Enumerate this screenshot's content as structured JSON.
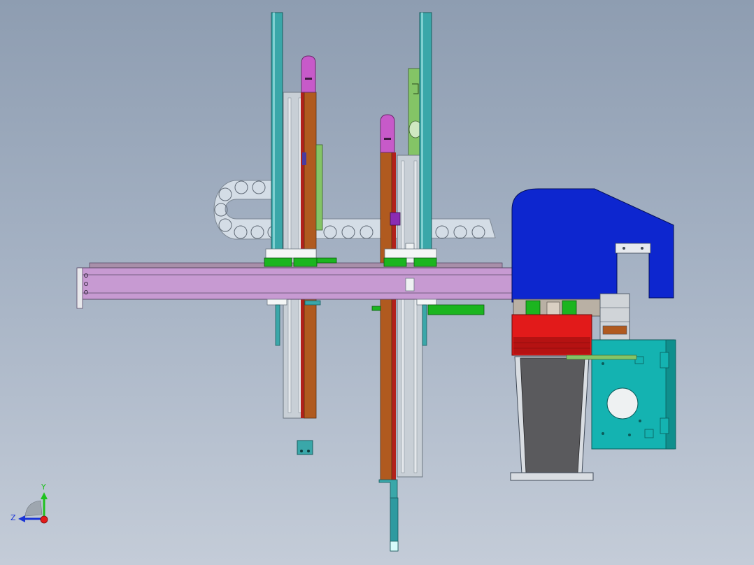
{
  "view": {
    "background_top": "#8e9db1",
    "background_bottom": "#c4ccd8"
  },
  "palette": {
    "rail_purple": "#c79ad2",
    "rail_dark": "#5b4a68",
    "pillar_teal": "#3aa7a9",
    "orange_plate": "#b05a1f",
    "red_strip": "#b2211b",
    "magenta_cap": "#c75ac9",
    "grey_plate": "#c8cfd6",
    "green_block": "#1bb51f",
    "lime_panel": "#84c466",
    "cable_chain": "#d4dde6",
    "blue_cover": "#0d26cf",
    "red_box": "#e21a1a",
    "dark_hopper": "#5a5a5d",
    "teal_bracket": "#14b3b1",
    "white_pad": "#f4f6f6"
  },
  "triad": {
    "y_label": "Y",
    "z_label": "Z",
    "y_color": "#1fc21f",
    "z_color": "#1a34d6",
    "x_color": "#e21a1a"
  }
}
